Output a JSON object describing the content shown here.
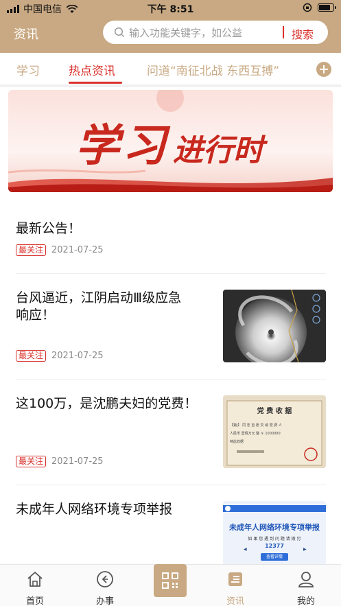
{
  "status_bar": {
    "carrier": "中国电信",
    "time": "下午 8:51",
    "battery_level": 0.85
  },
  "header": {
    "title": "资讯",
    "search_placeholder": "输入功能关键字，如公益",
    "search_button": "搜索",
    "icon": "search-icon"
  },
  "tabs": {
    "items": [
      "学习",
      "热点资讯",
      "问道“南征北战 东西互搏”"
    ],
    "active": "热点资讯",
    "add_icon": "plus-circle-icon"
  },
  "banner": {
    "title_part1": "学习",
    "title_part2": "进行时"
  },
  "news": [
    {
      "title": "最新公告！",
      "badge": "最关注",
      "date": "2021-07-25"
    },
    {
      "title_line1": "台风逼近，江阴启动Ⅲ级应急",
      "title_line2": "响应！",
      "badge": "最关注",
      "date": "2021-07-25",
      "thumb": "typhoon-satellite-image"
    },
    {
      "title": "这100万，是沈鹏夫妇的党费！",
      "badge": "最关注",
      "date": "2021-07-25",
      "thumb": "party-fee-receipt-image",
      "thumb_text": {
        "heading": "党 费 收 据",
        "line1": "【第J】 同 志 自 愿  交 纳 党 费 人",
        "line2": "人民币  壹佰万元  整 ￥ 1000000",
        "line3": "特此收据"
      }
    },
    {
      "title": "未成年人网络环境专项举报",
      "thumb": "report-poster-image",
      "thumb_text": {
        "heading": "未成年人网络环境专项举报",
        "line1": "如 果 您 遇 到 问 题 请 拨 打",
        "phone": "12377",
        "button": "查看详情"
      }
    }
  ],
  "tabbar": {
    "items": [
      {
        "label": "首页",
        "icon": "home-icon"
      },
      {
        "label": "办事",
        "icon": "service-icon"
      },
      {
        "label": "资讯",
        "icon": "news-icon",
        "active": true
      },
      {
        "label": "我的",
        "icon": "profile-icon"
      }
    ],
    "center_icon": "qr-scan-icon"
  },
  "colors": {
    "brand": "#c9a983",
    "accent": "#d9302a",
    "text": "#111111",
    "meta": "#8a8a8a"
  }
}
